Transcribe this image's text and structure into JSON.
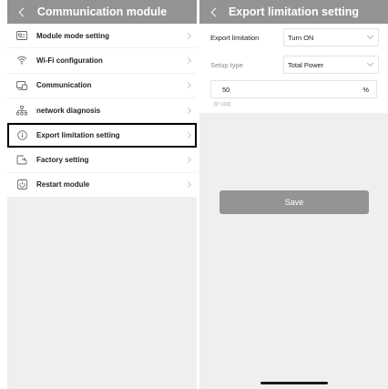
{
  "left": {
    "title": "Communication module",
    "items": [
      {
        "label": "Module mode setting",
        "icon": "module-mode-icon"
      },
      {
        "label": "Wi-Fi configuration",
        "icon": "wifi-icon"
      },
      {
        "label": "Communication",
        "icon": "communication-icon"
      },
      {
        "label": "network diagnosis",
        "icon": "network-icon"
      },
      {
        "label": "Export limitation setting",
        "icon": "info-icon"
      },
      {
        "label": "Factory setting",
        "icon": "factory-reset-icon"
      },
      {
        "label": "Restart module",
        "icon": "restart-icon"
      }
    ]
  },
  "right": {
    "title": "Export limitation setting",
    "export_limitation": {
      "label": "Export limitation",
      "value": "Turn ON"
    },
    "setup_type": {
      "label": "Setup type",
      "value": "Total Power"
    },
    "power_value": "50",
    "unit": "%",
    "range_hint": "[0~110]",
    "save_label": "Save"
  },
  "colors": {
    "header": "#939393",
    "background": "#efefef",
    "button": "#949494"
  }
}
